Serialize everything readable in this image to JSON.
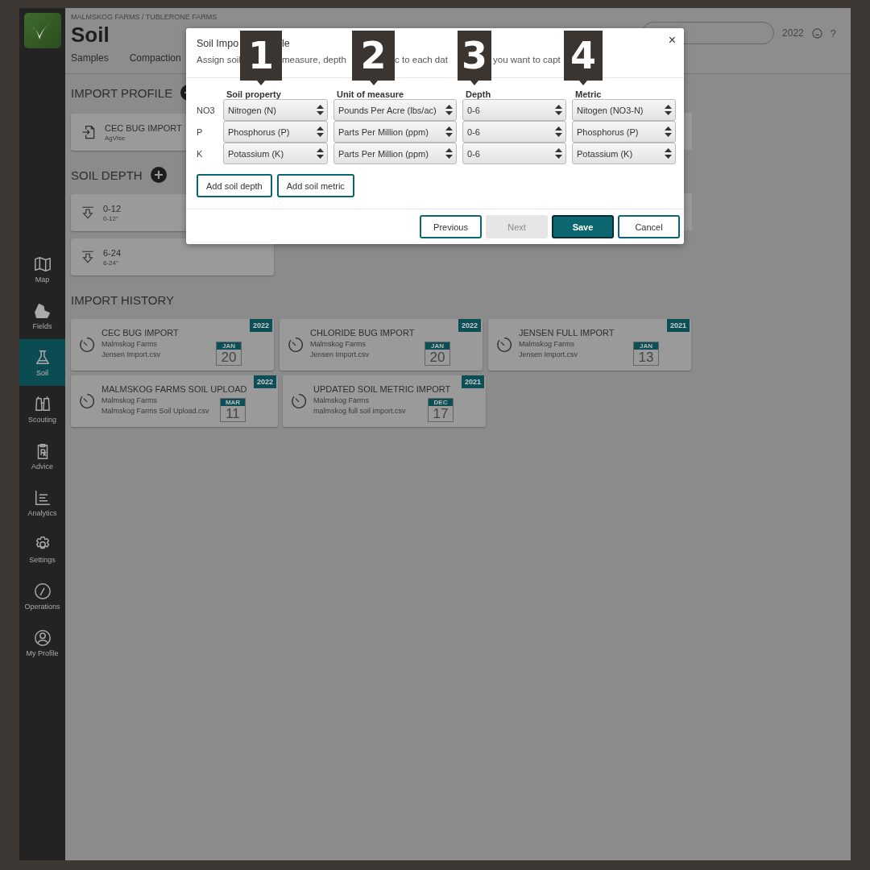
{
  "sidebar": {
    "items": [
      {
        "label": "Map",
        "selected": false
      },
      {
        "label": "Fields",
        "selected": false
      },
      {
        "label": "Soil",
        "selected": true
      },
      {
        "label": "Scouting",
        "selected": false
      },
      {
        "label": "Advice",
        "selected": false
      },
      {
        "label": "Analytics",
        "selected": false
      },
      {
        "label": "Settings",
        "selected": false
      },
      {
        "label": "Operations",
        "selected": false
      },
      {
        "label": "My Profile",
        "selected": false
      }
    ]
  },
  "header": {
    "breadcrumb": "MALMSKOG FARMS / TUBLERONE FARMS",
    "title": "Soil",
    "tabs": [
      "Samples",
      "Compaction"
    ],
    "year": "2022",
    "help": "?"
  },
  "import_profile": {
    "heading": "IMPORT PROFILE",
    "cards": [
      {
        "title": "CEC BUG IMPORT",
        "subtitle": "AgVise"
      }
    ]
  },
  "soil_depth": {
    "heading": "SOIL DEPTH",
    "cards": [
      {
        "title": "0-12",
        "subtitle": "0-12\""
      },
      {
        "title": "6-24",
        "subtitle": "6-24\""
      }
    ]
  },
  "import_history": {
    "heading": "IMPORT HISTORY",
    "cards": [
      {
        "title": "CEC BUG IMPORT",
        "farm": "Malmskog Farms",
        "file": "Jensen Import.csv",
        "year": "2022",
        "month": "JAN",
        "day": "20"
      },
      {
        "title": "CHLORIDE BUG IMPORT",
        "farm": "Malmskog Farms",
        "file": "Jensen Import.csv",
        "year": "2022",
        "month": "JAN",
        "day": "20"
      },
      {
        "title": "JENSEN FULL IMPORT",
        "farm": "Malmskog Farms",
        "file": "Jensen Import.csv",
        "year": "2021",
        "month": "JAN",
        "day": "13"
      },
      {
        "title": "MALMSKOG FARMS SOIL UPLOAD",
        "farm": "Malmskog Farms",
        "file": "Malmskog Farms Soil Upload.csv",
        "year": "2022",
        "month": "MAR",
        "day": "11"
      },
      {
        "title": "UPDATED SOIL METRIC IMPORT",
        "farm": "Malmskog Farms",
        "file": "malmskog full soil import.csv",
        "year": "2021",
        "month": "DEC",
        "day": "17"
      }
    ]
  },
  "dialog": {
    "title_parts": [
      "Soil Impo",
      "le"
    ],
    "subtitle_parts": [
      "Assign soil",
      "measure, depth",
      "c to each dat",
      "you want to capt"
    ],
    "close": "×",
    "columns": [
      "Soil property",
      "Unit of measure",
      "Depth",
      "Metric"
    ],
    "rows": [
      {
        "label": "NO3",
        "values": [
          "Nitrogen (N)",
          "Pounds Per Acre (lbs/ac)",
          "0-6",
          "Nitogen (NO3-N)"
        ]
      },
      {
        "label": "P",
        "values": [
          "Phosphorus (P)",
          "Parts Per Million (ppm)",
          "0-6",
          "Phosphorus (P)"
        ]
      },
      {
        "label": "K",
        "values": [
          "Potassium (K)",
          "Parts Per Million (ppm)",
          "0-6",
          "Potassium (K)"
        ]
      }
    ],
    "actions": [
      "Add soil depth",
      "Add soil metric"
    ],
    "buttons": [
      {
        "label": "Previous",
        "kind": "outline",
        "disabled": false
      },
      {
        "label": "Next",
        "kind": "outline",
        "disabled": true
      },
      {
        "label": "Save",
        "kind": "primary",
        "disabled": false
      },
      {
        "label": "Cancel",
        "kind": "outline",
        "disabled": false
      }
    ]
  },
  "callouts": [
    "1",
    "2",
    "3",
    "4"
  ]
}
